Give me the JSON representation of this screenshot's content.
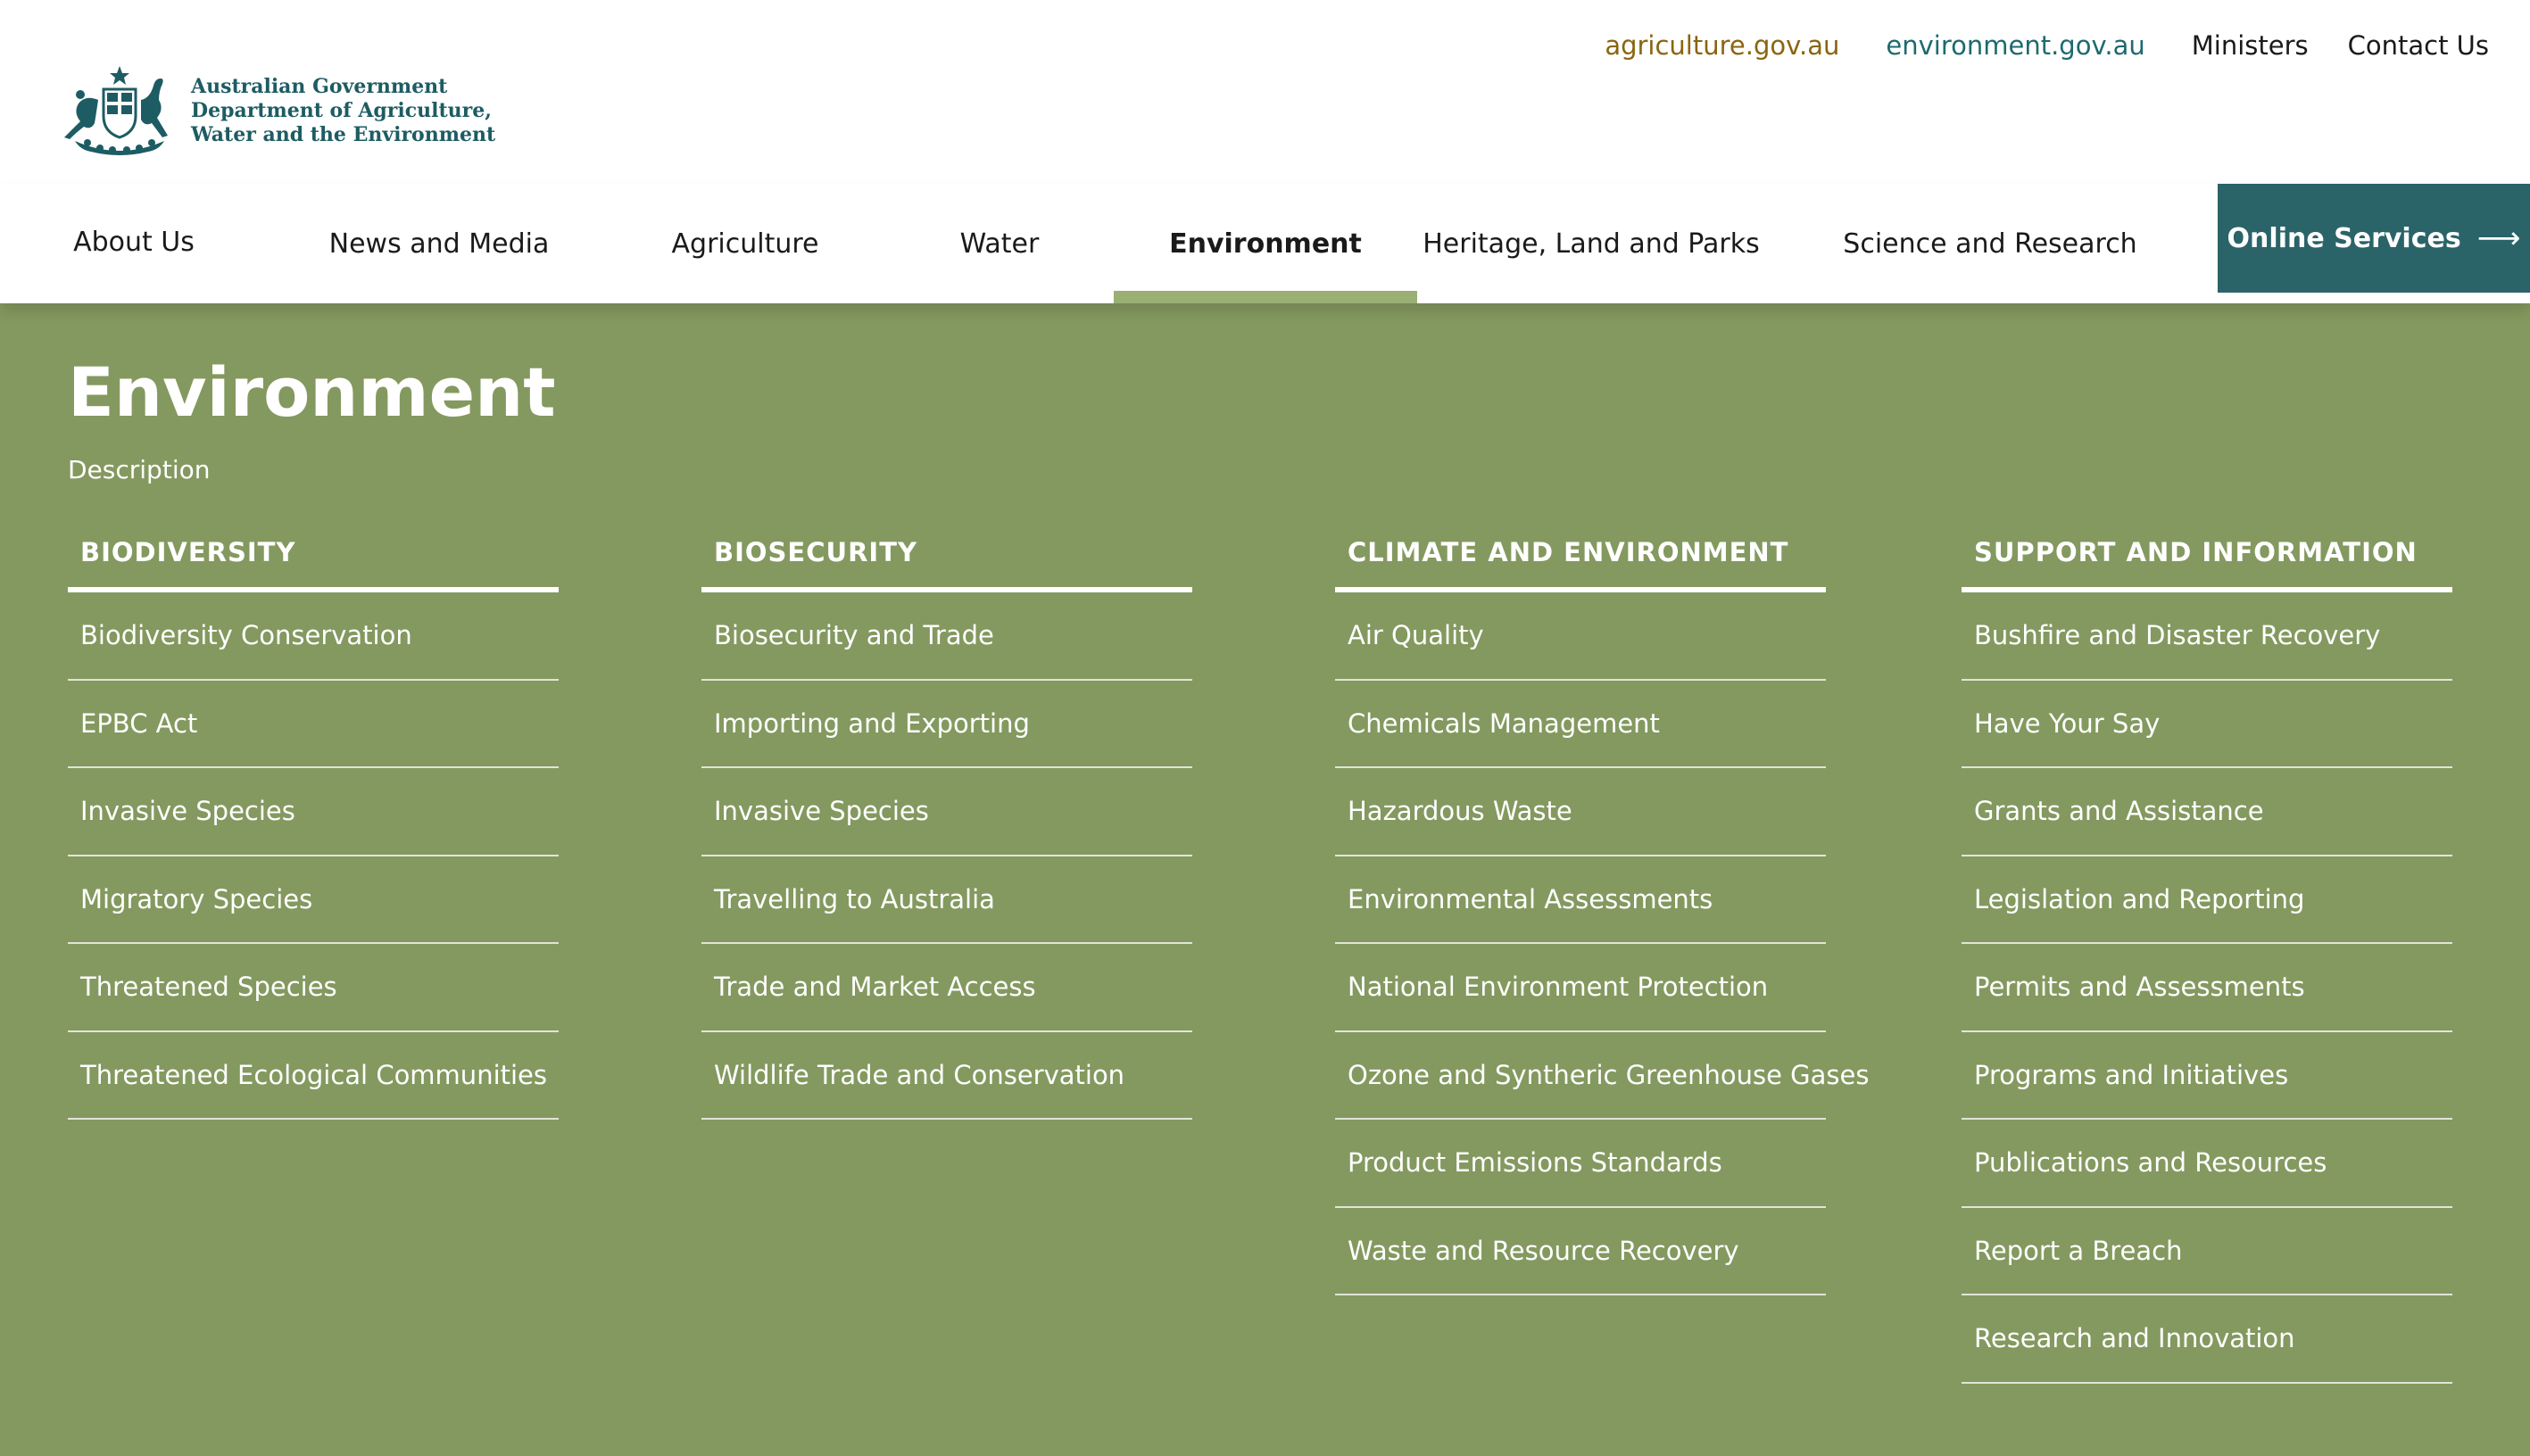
{
  "branding": {
    "logo_line1": "Australian Government",
    "logo_line2": "Department of Agriculture,",
    "logo_line3": "Water and the Environment",
    "logo_icon": "coat-of-arms-crest"
  },
  "utility_nav": {
    "agriculture_link": "agriculture.gov.au",
    "environment_link": "environment.gov.au",
    "ministers_link": "Ministers",
    "contact_link": "Contact Us"
  },
  "main_nav": {
    "items": [
      {
        "label": "About Us"
      },
      {
        "label": "News and Media"
      },
      {
        "label": "Agriculture"
      },
      {
        "label": "Water"
      },
      {
        "label": "Environment"
      },
      {
        "label": "Heritage, Land and Parks"
      },
      {
        "label": "Science and Research"
      }
    ],
    "active": "Environment",
    "online_services": "Online Services",
    "online_services_icon": "arrow-right-icon"
  },
  "mega_menu": {
    "title": "Environment",
    "description": "Description",
    "columns": [
      {
        "heading": "Biodiversity",
        "items": [
          "Biodiversity Conservation",
          "EPBC Act",
          "Invasive Species",
          "Migratory Species",
          "Threatened Species",
          "Threatened Ecological Communities"
        ]
      },
      {
        "heading": "Biosecurity",
        "items": [
          "Biosecurity and Trade",
          "Importing and Exporting",
          "Invasive Species",
          "Travelling to Australia",
          "Trade and Market Access",
          "Wildlife Trade and Conservation"
        ]
      },
      {
        "heading": "Climate and Environment",
        "items": [
          "Air Quality",
          "Chemicals Management",
          "Hazardous Waste",
          "Environmental Assessments",
          "National Environment Protection",
          "Ozone and Syntheric Greenhouse Gases",
          "Product Emissions Standards",
          "Waste and Resource Recovery"
        ]
      },
      {
        "heading": "Support and Information",
        "items": [
          "Bushfire and Disaster Recovery",
          "Have Your Say",
          "Grants and Assistance",
          "Legislation and Reporting",
          "Permits and Assessments",
          "Programs and Initiatives",
          "Publications and Resources",
          "Report a Breach",
          "Research and Innovation"
        ]
      }
    ]
  },
  "colors": {
    "panel_green": "#84995f",
    "active_tab_indicator": "#9aaf74",
    "online_services_bg": "#2a6469",
    "logo_teal": "#1d5c63",
    "agriculture_link": "#8a6510",
    "environment_link": "#1d6a70"
  }
}
